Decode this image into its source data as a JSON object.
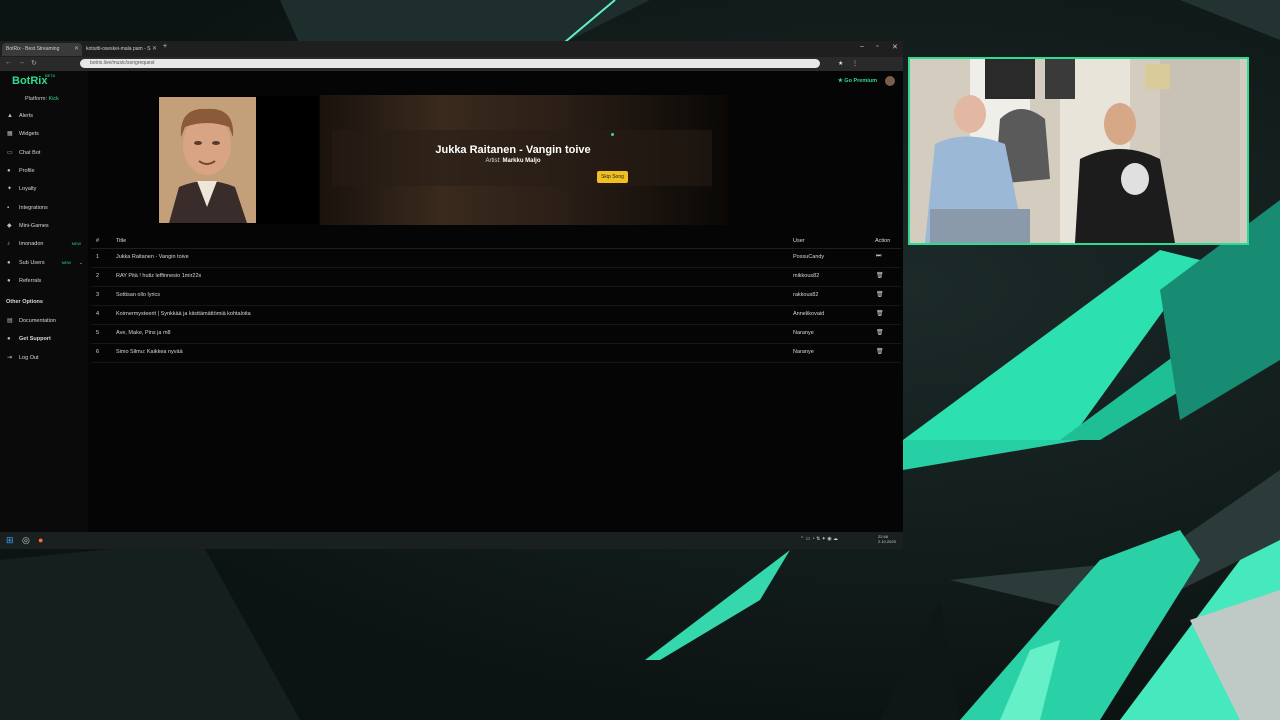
{
  "browser": {
    "tabs": [
      {
        "label": "BotRix - Best Streaming",
        "active": true
      },
      {
        "label": "kotiutti-oseskei-mala pam - S",
        "active": false
      }
    ],
    "new_tab": "+",
    "url": "botrix.live/music/songrequest"
  },
  "sidebar": {
    "logo": "BotRix",
    "beta": "BETA",
    "platform_label": "Platform:",
    "platform_value": "Kick",
    "items": [
      {
        "label": "Alerts",
        "icon": "bell-icon"
      },
      {
        "label": "Widgets",
        "icon": "grid-icon"
      },
      {
        "label": "Chat Bot",
        "icon": "chat-icon"
      },
      {
        "label": "Profile",
        "icon": "user-icon"
      },
      {
        "label": "Loyalty",
        "icon": "star-icon"
      },
      {
        "label": "Integrations",
        "icon": "plug-icon"
      },
      {
        "label": "Mini-Games",
        "icon": "game-icon"
      },
      {
        "label": "Imonadon",
        "icon": "music-icon",
        "badge": "NEW"
      },
      {
        "label": "Sub Users",
        "icon": "users-icon",
        "badge": "NEW"
      },
      {
        "label": "Referrals",
        "icon": "referral-icon"
      }
    ],
    "other_title": "Other Options",
    "other_items": [
      {
        "label": "Documentation",
        "icon": "doc-icon"
      },
      {
        "label": "Get Support",
        "icon": "support-icon"
      },
      {
        "label": "Log Out",
        "icon": "logout-icon"
      }
    ]
  },
  "header": {
    "premium": "Go Premium"
  },
  "now_playing": {
    "title": "Jukka Raitanen - Vangin toive",
    "artist_label": "Artist:",
    "artist": "Markku Maljo",
    "skip_label": "Skip Song"
  },
  "queue": {
    "columns": [
      "#",
      "Title",
      "User",
      "Action"
    ],
    "rows": [
      {
        "num": "1",
        "title": "Jukka Raitanen - Vangin toive",
        "user": "PossuCandy",
        "action": "skip"
      },
      {
        "num": "2",
        "title": "RAY Pitä ! hutiz leffinnesio 1mir22s",
        "user": "mikkous82",
        "action": "delete"
      },
      {
        "num": "3",
        "title": "Sottisan ollo lyrics",
        "user": "rakkous82",
        "action": "delete"
      },
      {
        "num": "4",
        "title": "Koirnermysteerit | Synkkää ja kiisttämättömiä kohtaloita",
        "user": "Annelikovaid",
        "action": "delete"
      },
      {
        "num": "5",
        "title": "Ave, Make, Pins ja m8",
        "user": "Naranye",
        "action": "delete"
      },
      {
        "num": "6",
        "title": "Simo Silmu: Kaikkea nyvää",
        "user": "Naranye",
        "action": "delete"
      }
    ]
  },
  "taskbar": {
    "time": "22:46",
    "date": "2.10.2025"
  },
  "colors": {
    "accent": "#2ddc8f",
    "skip_button": "#f0c020",
    "background": "#050505"
  }
}
